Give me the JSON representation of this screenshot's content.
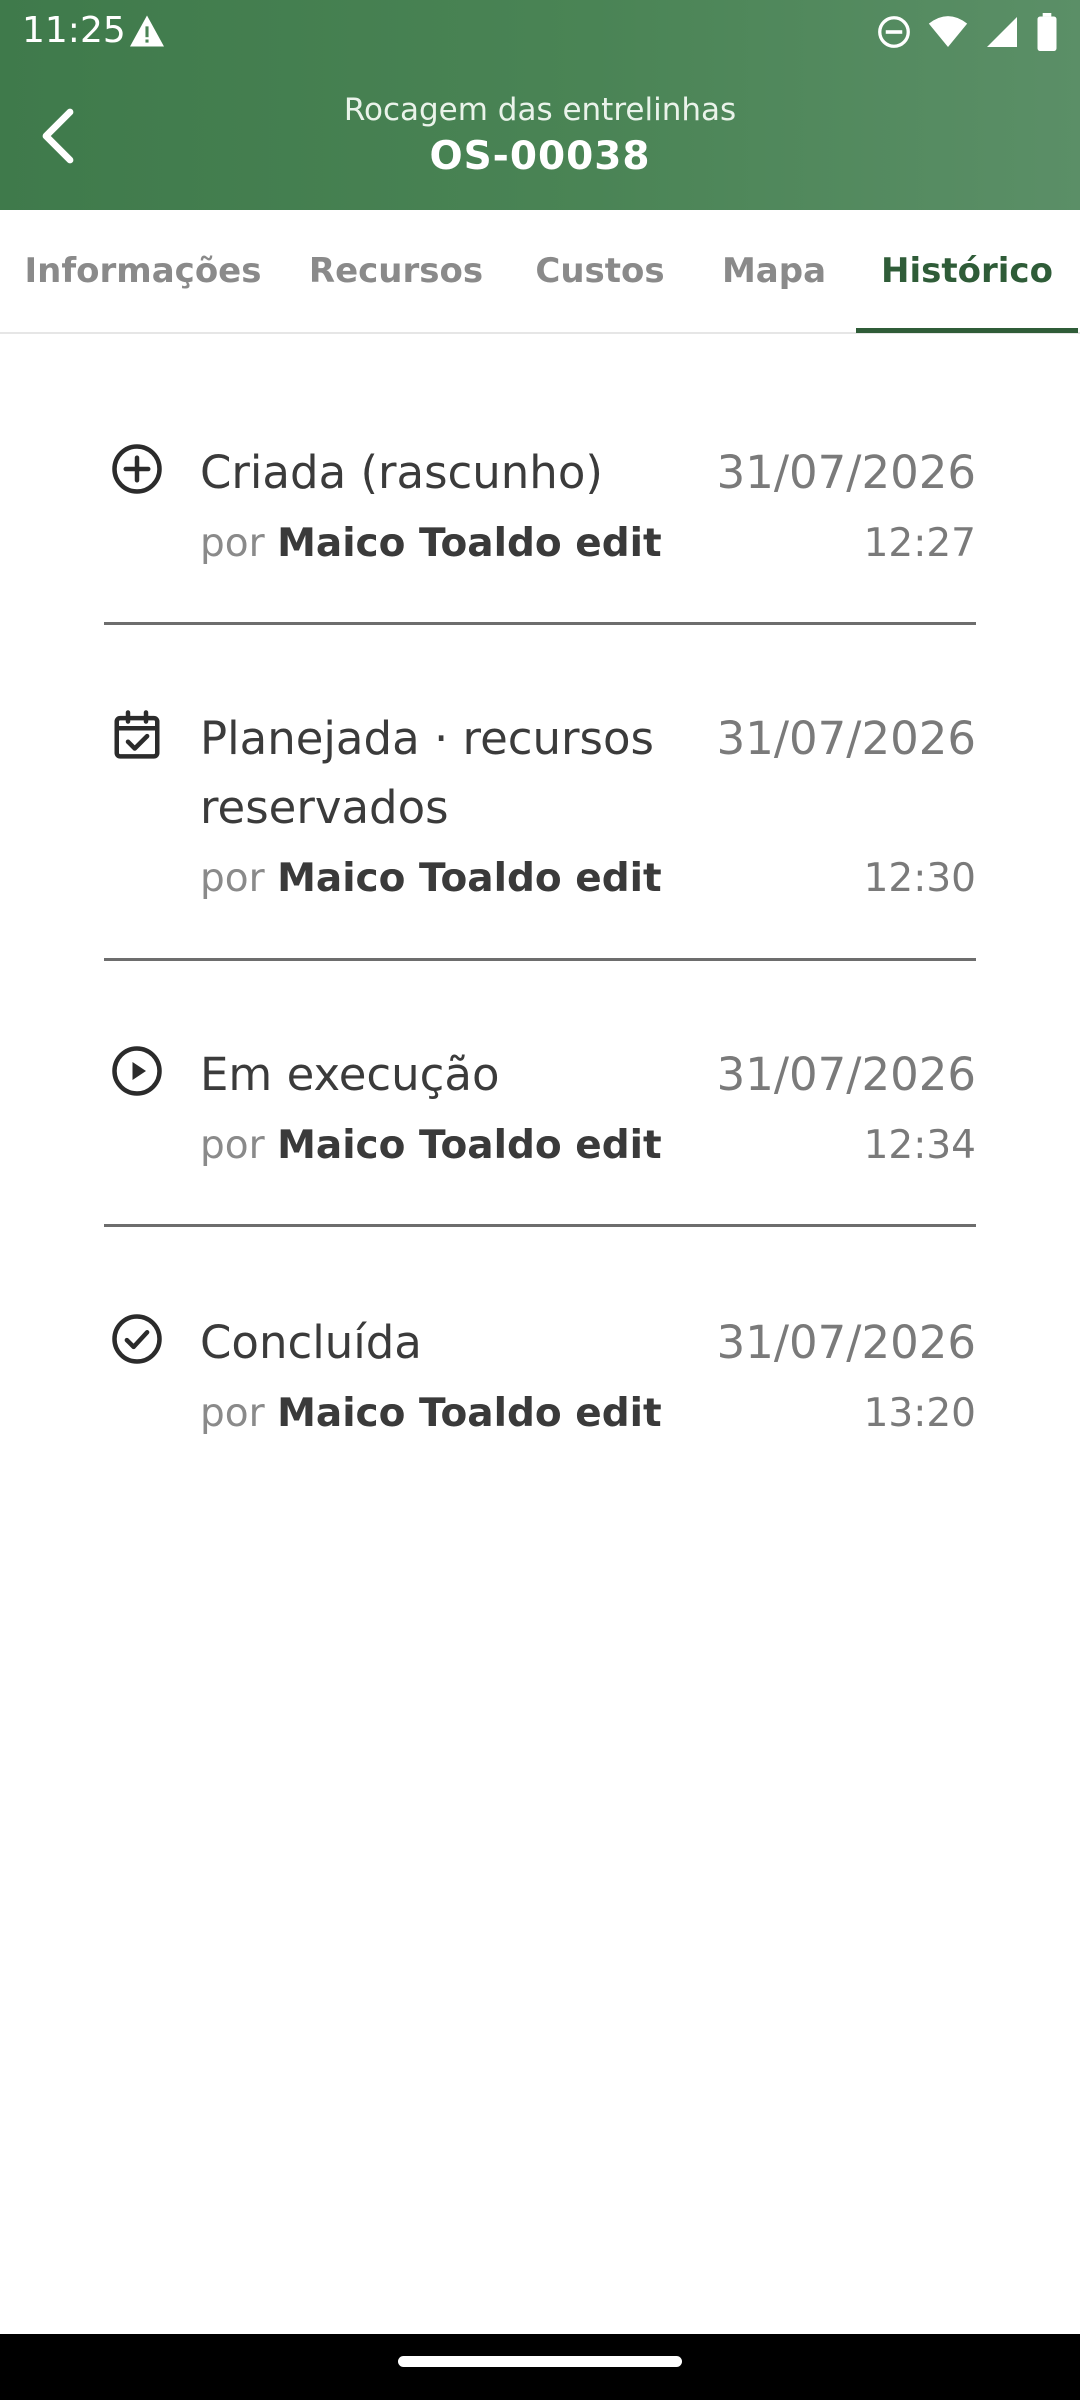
{
  "status_bar": {
    "time": "11:25",
    "icons": [
      "warning-icon",
      "do-not-disturb-icon",
      "wifi-icon",
      "signal-icon",
      "battery-icon"
    ]
  },
  "header": {
    "subtitle": "Rocagem das entrelinhas",
    "title": "OS-00038",
    "back_icon": "chevron-left-icon",
    "color": "#4a8455"
  },
  "tabs": [
    {
      "label": "Informações",
      "active": false
    },
    {
      "label": "Recursos",
      "active": false
    },
    {
      "label": "Custos",
      "active": false
    },
    {
      "label": "Mapa",
      "active": false
    },
    {
      "label": "Histórico",
      "active": true
    }
  ],
  "history": [
    {
      "icon": "add-circle-icon",
      "title": "Criada (rascunho)",
      "by_prefix": "por",
      "user": "Maico Toaldo edit",
      "date": "31/07/2026",
      "time": "12:27"
    },
    {
      "icon": "calendar-check-icon",
      "title": "Planejada · recursos reservados",
      "by_prefix": "por",
      "user": "Maico Toaldo edit",
      "date": "31/07/2026",
      "time": "12:30"
    },
    {
      "icon": "play-circle-icon",
      "title": "Em execução",
      "by_prefix": "por",
      "user": "Maico Toaldo edit",
      "date": "31/07/2026",
      "time": "12:34"
    },
    {
      "icon": "check-circle-icon",
      "title": "Concluída",
      "by_prefix": "por",
      "user": "Maico Toaldo edit",
      "date": "31/07/2026",
      "time": "13:20"
    }
  ],
  "colors": {
    "accent": "#2f5c38",
    "header": "#4a8455"
  }
}
